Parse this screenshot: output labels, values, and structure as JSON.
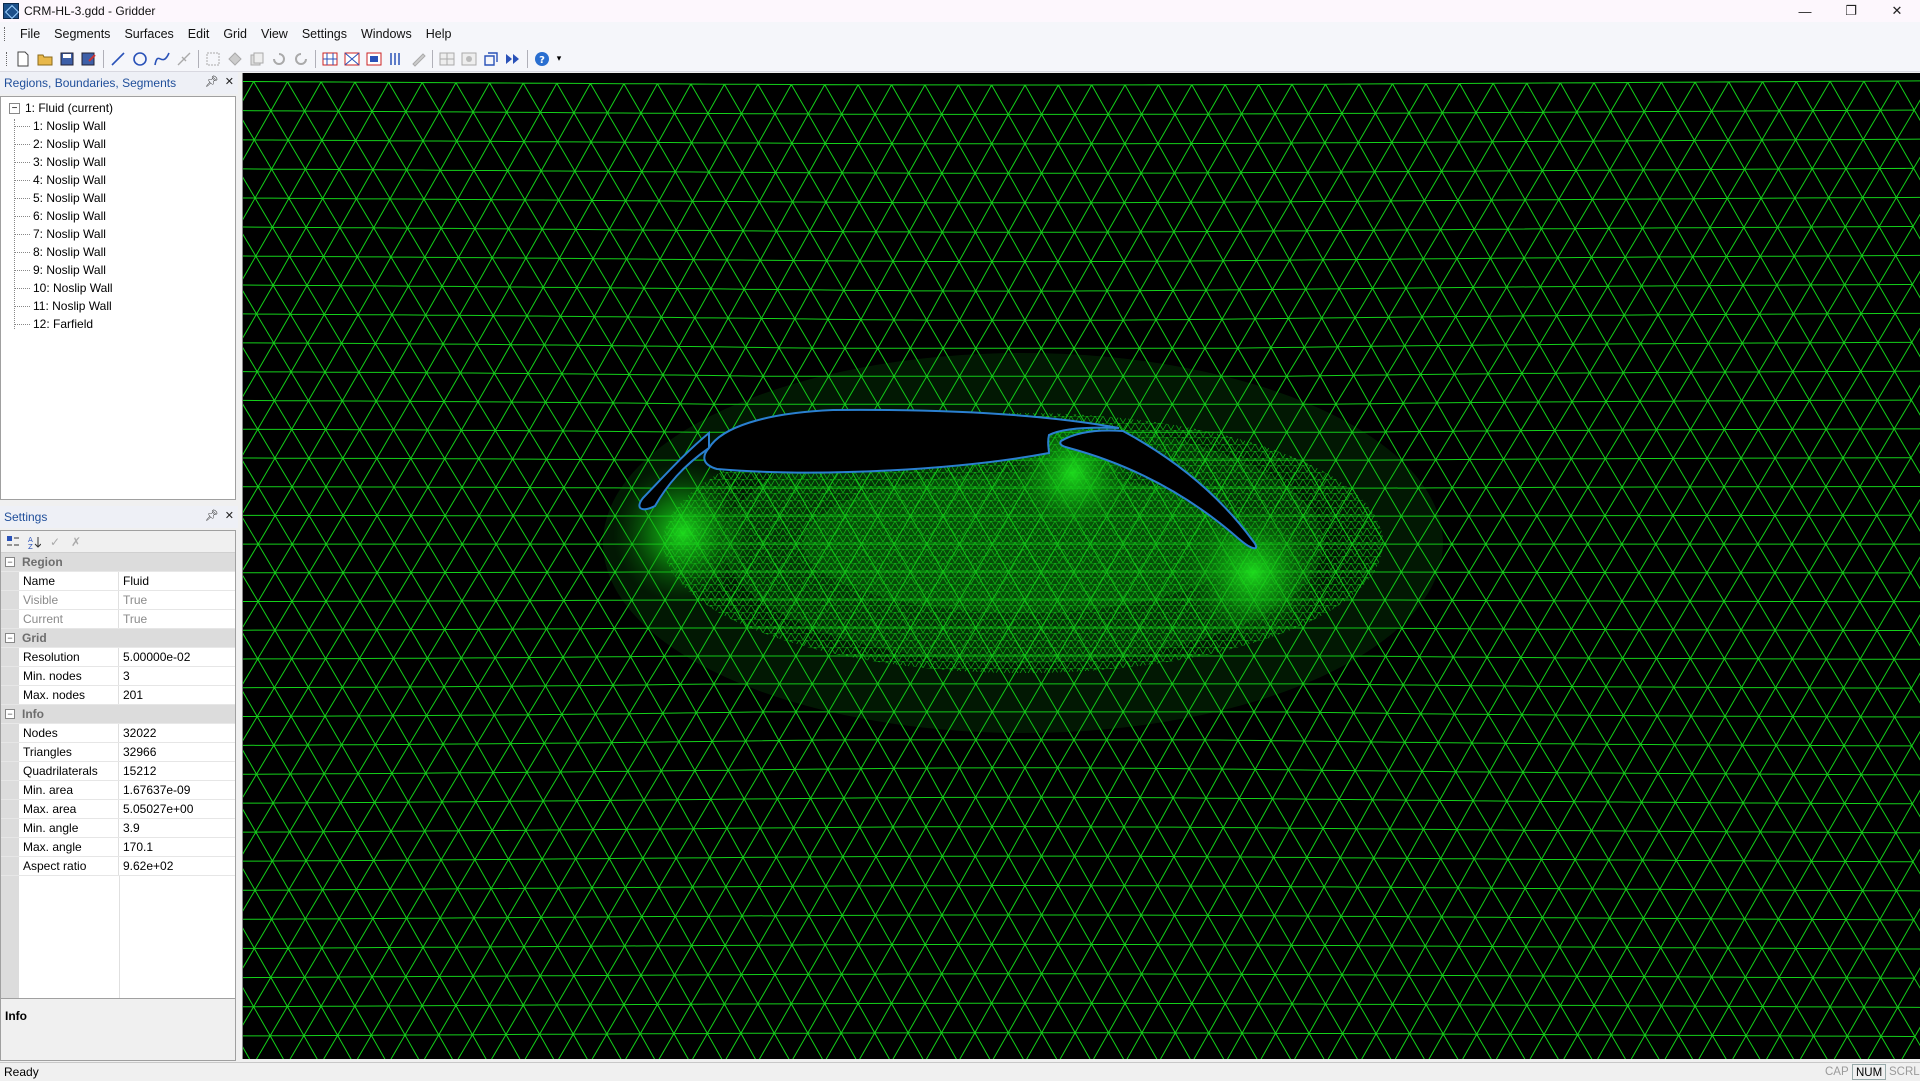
{
  "window": {
    "title": "CRM-HL-3.gdd - Gridder",
    "controls": {
      "minimize": "—",
      "maximize": "❐",
      "close": "✕"
    }
  },
  "menu": [
    "File",
    "Segments",
    "Surfaces",
    "Edit",
    "Grid",
    "View",
    "Settings",
    "Windows",
    "Help"
  ],
  "tree_panel": {
    "title": "Regions, Boundaries, Segments",
    "root": "1: Fluid (current)",
    "children": [
      "1: Noslip Wall",
      "2: Noslip Wall",
      "3: Noslip Wall",
      "4: Noslip Wall",
      "5: Noslip Wall",
      "6: Noslip Wall",
      "7: Noslip Wall",
      "8: Noslip Wall",
      "9: Noslip Wall",
      "10: Noslip Wall",
      "11: Noslip Wall",
      "12: Farfield"
    ]
  },
  "settings_panel": {
    "title": "Settings",
    "categories": [
      {
        "name": "Region",
        "rows": [
          {
            "name": "Name",
            "value": "Fluid",
            "readonly": false
          },
          {
            "name": "Visible",
            "value": "True",
            "readonly": true
          },
          {
            "name": "Current",
            "value": "True",
            "readonly": true
          }
        ]
      },
      {
        "name": "Grid",
        "rows": [
          {
            "name": "Resolution",
            "value": "5.00000e-02",
            "readonly": false
          },
          {
            "name": "Min. nodes",
            "value": "3",
            "readonly": false
          },
          {
            "name": "Max. nodes",
            "value": "201",
            "readonly": false
          }
        ]
      },
      {
        "name": "Info",
        "rows": [
          {
            "name": "Nodes",
            "value": "32022",
            "readonly": false
          },
          {
            "name": "Triangles",
            "value": "32966",
            "readonly": false
          },
          {
            "name": "Quadrilaterals",
            "value": "15212",
            "readonly": false
          },
          {
            "name": "Min. area",
            "value": "1.67637e-09",
            "readonly": false
          },
          {
            "name": "Max. area",
            "value": "5.05027e+00",
            "readonly": false
          },
          {
            "name": "Min. angle",
            "value": "3.9",
            "readonly": false
          },
          {
            "name": "Max. angle",
            "value": "170.1",
            "readonly": false
          },
          {
            "name": "Aspect ratio",
            "value": "9.62e+02",
            "readonly": false
          }
        ]
      }
    ],
    "info_box_title": "Info"
  },
  "statusbar": {
    "text": "Ready",
    "indicators": [
      {
        "label": "CAP",
        "active": false
      },
      {
        "label": "NUM",
        "active": true
      },
      {
        "label": "SCRL",
        "active": false
      }
    ]
  },
  "colors": {
    "mesh_line": "#14d01a",
    "mesh_background": "#000000",
    "body_outline": "#2a7fd0",
    "panel_title": "#1f4e9a"
  }
}
